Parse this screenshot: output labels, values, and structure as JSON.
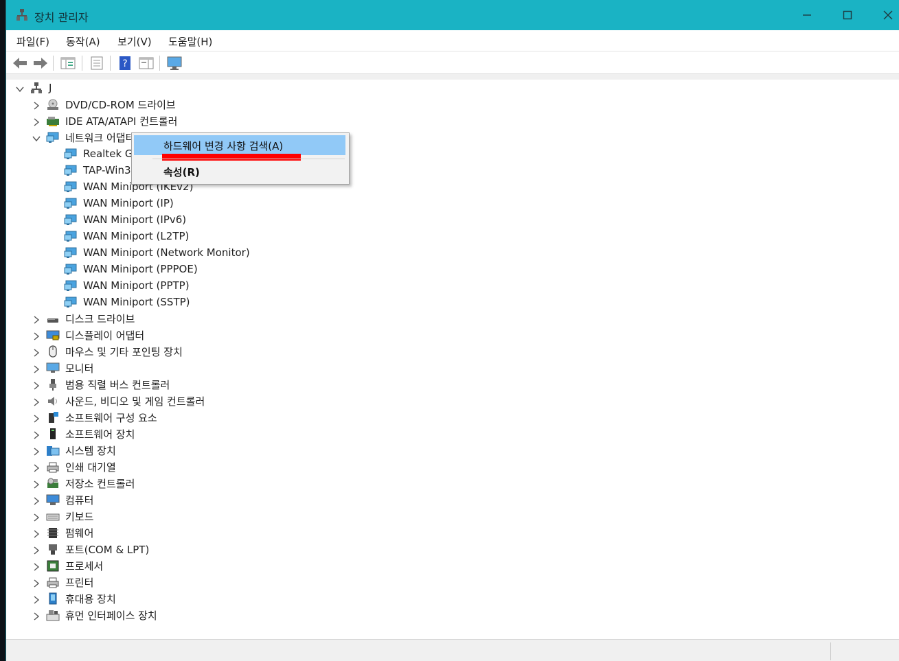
{
  "window": {
    "title": "장치 관리자"
  },
  "menu": [
    "파일(F)",
    "동작(A)",
    "보기(V)",
    "도움말(H)"
  ],
  "toolbar": [
    "back-icon",
    "forward-icon",
    "show-hide-tree-icon",
    "properties-icon",
    "help-icon",
    "action-pane-icon",
    "monitor-icon"
  ],
  "tree": {
    "root": "J",
    "items": [
      {
        "label": "DVD/CD-ROM 드라이브",
        "icon": "dvd-drive-icon",
        "expanded": false
      },
      {
        "label": "IDE ATA/ATAPI 컨트롤러",
        "icon": "ide-controller-icon",
        "expanded": false
      },
      {
        "label": "네트워크 어댑터",
        "icon": "network-adapter-icon",
        "expanded": true
      },
      {
        "label": "디스크 드라이브",
        "icon": "disk-drive-icon",
        "expanded": false
      },
      {
        "label": "디스플레이 어댑터",
        "icon": "display-adapter-icon",
        "expanded": false
      },
      {
        "label": "마우스 및 기타 포인팅 장치",
        "icon": "mouse-icon",
        "expanded": false
      },
      {
        "label": "모니터",
        "icon": "monitor-icon",
        "expanded": false
      },
      {
        "label": "범용 직렬 버스 컨트롤러",
        "icon": "usb-icon",
        "expanded": false
      },
      {
        "label": "사운드, 비디오 및 게임 컨트롤러",
        "icon": "speaker-icon",
        "expanded": false
      },
      {
        "label": "소프트웨어 구성 요소",
        "icon": "software-component-icon",
        "expanded": false
      },
      {
        "label": "소프트웨어 장치",
        "icon": "software-device-icon",
        "expanded": false
      },
      {
        "label": "시스템 장치",
        "icon": "system-device-icon",
        "expanded": false
      },
      {
        "label": "인쇄 대기열",
        "icon": "print-queue-icon",
        "expanded": false
      },
      {
        "label": "저장소 컨트롤러",
        "icon": "storage-controller-icon",
        "expanded": false
      },
      {
        "label": "컴퓨터",
        "icon": "computer-icon",
        "expanded": false
      },
      {
        "label": "키보드",
        "icon": "keyboard-icon",
        "expanded": false
      },
      {
        "label": "펌웨어",
        "icon": "firmware-icon",
        "expanded": false
      },
      {
        "label": "포트(COM & LPT)",
        "icon": "port-icon",
        "expanded": false
      },
      {
        "label": "프로세서",
        "icon": "processor-icon",
        "expanded": false
      },
      {
        "label": "프린터",
        "icon": "printer-icon",
        "expanded": false
      },
      {
        "label": "휴대용 장치",
        "icon": "portable-device-icon",
        "expanded": false
      },
      {
        "label": "휴먼 인터페이스 장치",
        "icon": "hid-icon",
        "expanded": false
      }
    ],
    "network_children": [
      "Realtek G",
      "TAP-Win3",
      "WAN Miniport (IKEv2)",
      "WAN Miniport (IP)",
      "WAN Miniport (IPv6)",
      "WAN Miniport (L2TP)",
      "WAN Miniport (Network Monitor)",
      "WAN Miniport (PPPOE)",
      "WAN Miniport (PPTP)",
      "WAN Miniport (SSTP)"
    ]
  },
  "context_menu": {
    "items": [
      "하드웨어 변경 사항 검색(A)",
      "속성(R)"
    ],
    "highlighted": 0
  },
  "colors": {
    "titlebar": "#1ab3c4",
    "highlight": "#91c9f7",
    "annotation": "#ff0000"
  }
}
